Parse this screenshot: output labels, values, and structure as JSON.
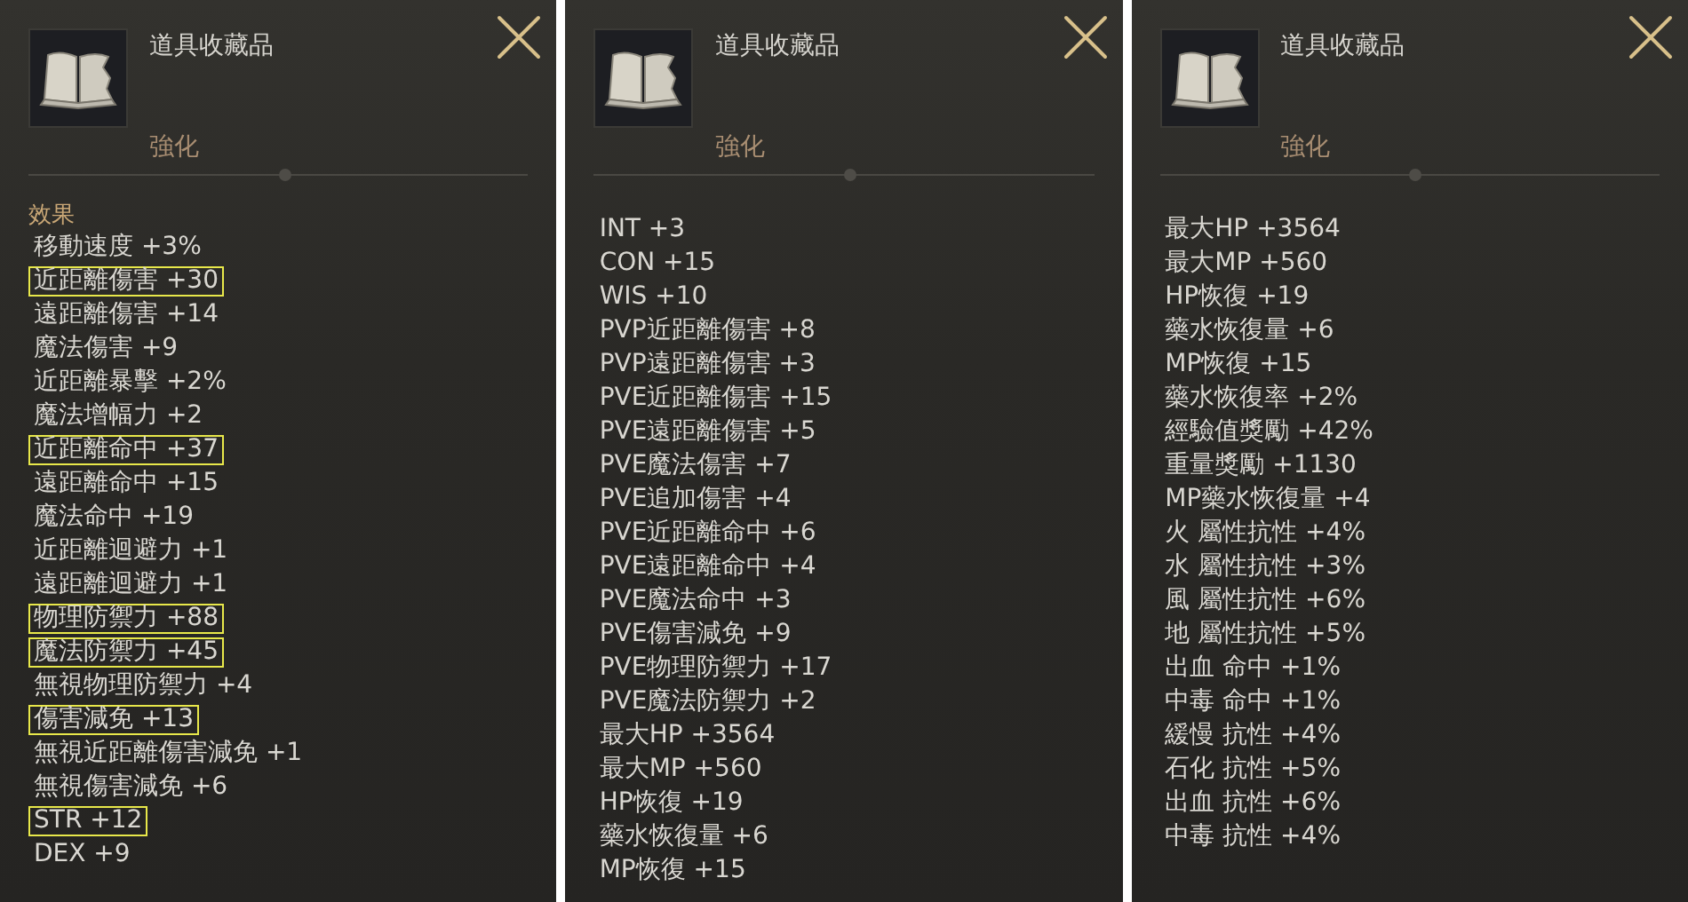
{
  "panels": [
    {
      "title": "道具收藏品",
      "subtitle": "強化",
      "section_label": "效果",
      "stats": [
        {
          "text": "移動速度 +3%",
          "highlighted": false
        },
        {
          "text": "近距離傷害 +30",
          "highlighted": true
        },
        {
          "text": "遠距離傷害 +14",
          "highlighted": false
        },
        {
          "text": "魔法傷害 +9",
          "highlighted": false
        },
        {
          "text": "近距離暴擊 +2%",
          "highlighted": false
        },
        {
          "text": "魔法增幅力 +2",
          "highlighted": false
        },
        {
          "text": "近距離命中 +37",
          "highlighted": true
        },
        {
          "text": "遠距離命中 +15",
          "highlighted": false
        },
        {
          "text": "魔法命中 +19",
          "highlighted": false
        },
        {
          "text": "近距離迴避力 +1",
          "highlighted": false
        },
        {
          "text": "遠距離迴避力 +1",
          "highlighted": false
        },
        {
          "text": "物理防禦力 +88",
          "highlighted": true
        },
        {
          "text": "魔法防禦力 +45",
          "highlighted": true
        },
        {
          "text": "無視物理防禦力 +4",
          "highlighted": false
        },
        {
          "text": "傷害減免 +13",
          "highlighted": true
        },
        {
          "text": "無視近距離傷害減免 +1",
          "highlighted": false
        },
        {
          "text": "無視傷害減免 +6",
          "highlighted": false
        },
        {
          "text": "STR +12",
          "highlighted": true
        },
        {
          "text": "DEX +9",
          "highlighted": false
        }
      ]
    },
    {
      "title": "道具收藏品",
      "subtitle": "強化",
      "stats": [
        {
          "text": "INT +3",
          "highlighted": false
        },
        {
          "text": "CON +15",
          "highlighted": false
        },
        {
          "text": "WIS +10",
          "highlighted": false
        },
        {
          "text": "PVP近距離傷害 +8",
          "highlighted": false
        },
        {
          "text": "PVP遠距離傷害 +3",
          "highlighted": false
        },
        {
          "text": "PVE近距離傷害 +15",
          "highlighted": false
        },
        {
          "text": "PVE遠距離傷害 +5",
          "highlighted": false
        },
        {
          "text": "PVE魔法傷害 +7",
          "highlighted": false
        },
        {
          "text": "PVE追加傷害 +4",
          "highlighted": false
        },
        {
          "text": "PVE近距離命中 +6",
          "highlighted": false
        },
        {
          "text": "PVE遠距離命中 +4",
          "highlighted": false
        },
        {
          "text": "PVE魔法命中 +3",
          "highlighted": false
        },
        {
          "text": "PVE傷害減免 +9",
          "highlighted": false
        },
        {
          "text": "PVE物理防禦力 +17",
          "highlighted": false
        },
        {
          "text": "PVE魔法防禦力 +2",
          "highlighted": false
        },
        {
          "text": "最大HP +3564",
          "highlighted": false
        },
        {
          "text": "最大MP +560",
          "highlighted": false
        },
        {
          "text": "HP恢復 +19",
          "highlighted": false
        },
        {
          "text": "藥水恢復量 +6",
          "highlighted": false
        },
        {
          "text": "MP恢復 +15",
          "highlighted": false
        }
      ]
    },
    {
      "title": "道具收藏品",
      "subtitle": "強化",
      "stats": [
        {
          "text": "最大HP +3564",
          "highlighted": false
        },
        {
          "text": "最大MP +560",
          "highlighted": false
        },
        {
          "text": "HP恢復 +19",
          "highlighted": false
        },
        {
          "text": "藥水恢復量 +6",
          "highlighted": false
        },
        {
          "text": "MP恢復 +15",
          "highlighted": false
        },
        {
          "text": "藥水恢復率 +2%",
          "highlighted": false
        },
        {
          "text": "經驗值獎勵 +42%",
          "highlighted": false
        },
        {
          "text": "重量獎勵 +1130",
          "highlighted": false
        },
        {
          "text": "MP藥水恢復量 +4",
          "highlighted": false
        },
        {
          "text": "火 屬性抗性 +4%",
          "highlighted": false
        },
        {
          "text": "水 屬性抗性 +3%",
          "highlighted": false
        },
        {
          "text": "風 屬性抗性 +6%",
          "highlighted": false
        },
        {
          "text": "地 屬性抗性 +5%",
          "highlighted": false
        },
        {
          "text": "出血 命中 +1%",
          "highlighted": false
        },
        {
          "text": "中毒 命中 +1%",
          "highlighted": false
        },
        {
          "text": "緩慢 抗性 +4%",
          "highlighted": false
        },
        {
          "text": "石化 抗性 +5%",
          "highlighted": false
        },
        {
          "text": "出血 抗性 +6%",
          "highlighted": false
        },
        {
          "text": "中毒 抗性 +4%",
          "highlighted": false
        }
      ]
    }
  ]
}
